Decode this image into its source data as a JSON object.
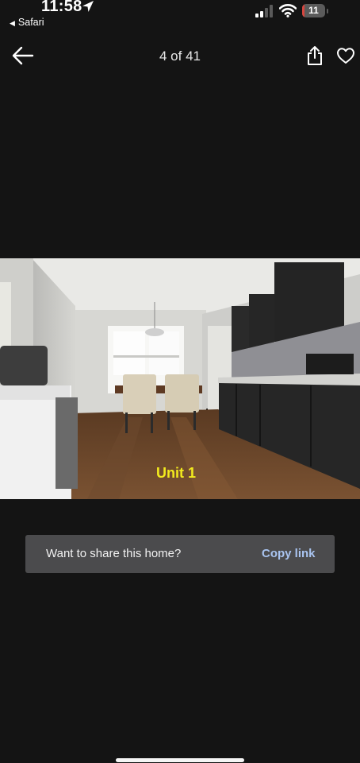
{
  "status_bar": {
    "time": "11:58",
    "back_app": "Safari",
    "battery_level": "11",
    "battery_fraction": 0.11,
    "accent_battery": "#d8463f"
  },
  "nav": {
    "counter": "4 of 41",
    "back_icon": "arrow-left-icon",
    "share_icon": "share-icon",
    "favorite_icon": "heart-outline-icon"
  },
  "photo": {
    "watermark": "Unit 1",
    "watermark_color": "#f2ea1e"
  },
  "share_toast": {
    "message": "Want to share this home?",
    "action_label": "Copy link",
    "action_color": "#a9c4f0"
  }
}
